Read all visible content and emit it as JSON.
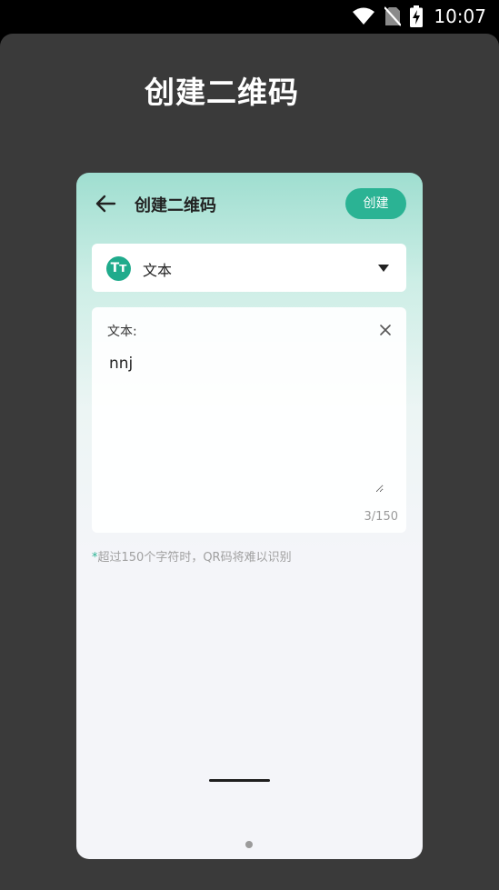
{
  "status_bar": {
    "time": "10:07",
    "icons": [
      "wifi-icon",
      "no-sim-icon",
      "battery-charging-icon"
    ]
  },
  "promo": {
    "title": "创建二维码"
  },
  "app": {
    "header": {
      "back_icon": "arrow-left-icon",
      "title": "创建二维码",
      "create_label": "创建"
    },
    "type_select": {
      "icon_text": "Tт",
      "label": "文本",
      "caret_icon": "caret-down-icon"
    },
    "text_field": {
      "label": "文本:",
      "value": "nnj",
      "clear_icon": "close-icon",
      "counter": "3/150"
    },
    "hint": {
      "star": "*",
      "text": "超过150个字符时，QR码将难以识别"
    }
  },
  "colors": {
    "accent": "#2bb394",
    "type_icon_bg": "#20ab8c",
    "outer_background": "#3a3a3a",
    "header_gradient_top": "#9fded0",
    "page_background": "#f4f5f9"
  }
}
